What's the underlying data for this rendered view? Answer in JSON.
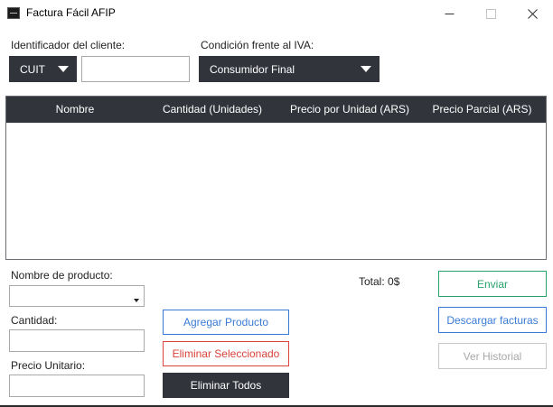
{
  "window": {
    "title": "Factura Fácil AFIP",
    "minimize_icon": "minimize-icon",
    "maximize_icon": "maximize-icon",
    "close_icon": "close-icon"
  },
  "client": {
    "identifier_label": "Identificador del cliente:",
    "id_type_selected": "CUIT",
    "id_value": "",
    "iva_label": "Condición frente al IVA:",
    "iva_selected": "Consumidor Final"
  },
  "table": {
    "columns": [
      "Nombre",
      "Cantidad (Unidades)",
      "Precio por Unidad (ARS)",
      "Precio Parcial (ARS)"
    ],
    "rows": []
  },
  "product_form": {
    "name_label": "Nombre de producto:",
    "name_value": "",
    "quantity_label": "Cantidad:",
    "quantity_value": "",
    "unit_price_label": "Precio Unitario:",
    "unit_price_value": ""
  },
  "actions": {
    "add_label": "Agregar Producto",
    "remove_selected_label": "Eliminar Seleccionado",
    "remove_all_label": "Eliminar Todos"
  },
  "summary": {
    "total_text": "Total: 0$"
  },
  "side_actions": {
    "send_label": "Enviar",
    "download_label": "Descargar facturas",
    "history_label": "Ver Historial"
  },
  "colors": {
    "dark": "#31343b",
    "blue": "#3a7bd5",
    "red": "#d9433b",
    "green": "#27a36a",
    "disabled": "#a8a8a8"
  }
}
